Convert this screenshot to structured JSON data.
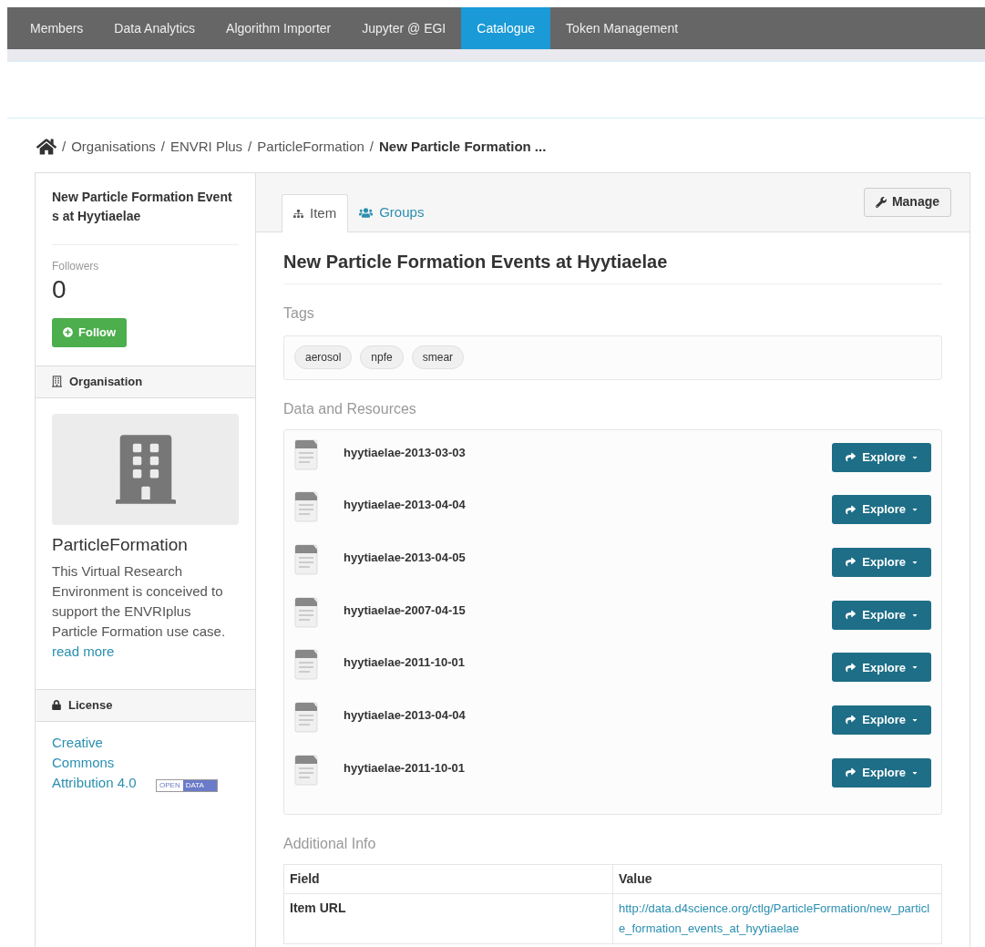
{
  "nav": [
    {
      "label": "Members",
      "selected": false
    },
    {
      "label": "Data Analytics",
      "selected": false
    },
    {
      "label": "Algorithm Importer",
      "selected": false
    },
    {
      "label": "Jupyter @ EGI",
      "selected": false
    },
    {
      "label": "Catalogue",
      "selected": true
    },
    {
      "label": "Token Management",
      "selected": false
    }
  ],
  "breadcrumb": [
    {
      "separator": "/",
      "label": "Organisations"
    },
    {
      "separator": "/",
      "label": "ENVRI Plus"
    },
    {
      "separator": "/",
      "label": "ParticleFormation"
    },
    {
      "separator": "/",
      "label": "New Particle Formation ..."
    }
  ],
  "sidebar": {
    "title": "New Particle Formation Events at Hyytiaelae",
    "followers_label": "Followers",
    "followers_count": "0",
    "follow_button": "Follow",
    "organisation_heading": "Organisation",
    "org_name": "ParticleFormation",
    "org_description": "This Virtual Research Environment is conceived to support the ENVRIplus Particle Formation use case.",
    "read_more": "read more",
    "license_heading": "License",
    "license_link": "Creative Commons Attribution 4.0",
    "license_badge": [
      "OPEN",
      "DATA"
    ]
  },
  "tabs": [
    {
      "label": "Item",
      "selected": true
    },
    {
      "label": "Groups",
      "selected": false
    }
  ],
  "manage_button": "Manage",
  "title": "New Particle Formation Events at Hyytiaelae",
  "tags_heading": "Tags",
  "tags": [
    "aerosol",
    "npfe",
    "smear"
  ],
  "resources_heading": "Data and Resources",
  "resources": [
    {
      "name": "hyytiaelae-2013-03-03",
      "button": "Explore"
    },
    {
      "name": "hyytiaelae-2013-04-04",
      "button": "Explore"
    },
    {
      "name": "hyytiaelae-2013-04-05",
      "button": "Explore"
    },
    {
      "name": "hyytiaelae-2007-04-15",
      "button": "Explore"
    },
    {
      "name": "hyytiaelae-2011-10-01",
      "button": "Explore"
    },
    {
      "name": "hyytiaelae-2013-04-04",
      "button": "Explore"
    },
    {
      "name": "hyytiaelae-2011-10-01",
      "button": "Explore"
    }
  ],
  "info_heading": "Additional Info",
  "info_table": {
    "columns": [
      "Field",
      "Value"
    ],
    "rows": [
      [
        "Item URL",
        "http://data.d4science.org/ctlg/ParticleFormation/new_particle_formation_events_at_hyytiaelae"
      ]
    ]
  }
}
